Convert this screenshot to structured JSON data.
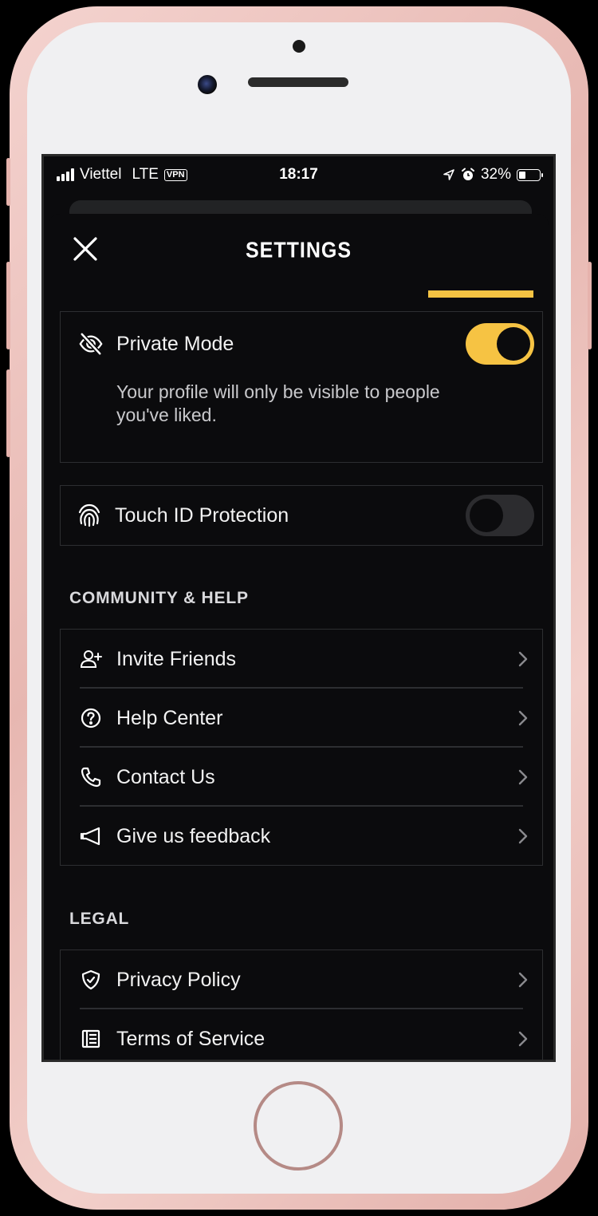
{
  "status_bar": {
    "carrier": "Viettel",
    "network": "LTE",
    "vpn": "VPN",
    "time": "18:17",
    "battery": "32%"
  },
  "header": {
    "title": "SETTINGS",
    "close_icon": "close-icon"
  },
  "accent_color": "#f6c343",
  "private_mode": {
    "label": "Private Mode",
    "description": "Your profile will only be visible to people you've liked.",
    "enabled": true
  },
  "touch_id": {
    "label": "Touch ID Protection",
    "enabled": false
  },
  "community": {
    "section_title": "COMMUNITY & HELP",
    "items": [
      {
        "label": "Invite Friends",
        "icon": "add-user-icon"
      },
      {
        "label": "Help Center",
        "icon": "question-icon"
      },
      {
        "label": "Contact Us",
        "icon": "phone-icon"
      },
      {
        "label": "Give us feedback",
        "icon": "megaphone-icon"
      }
    ]
  },
  "legal": {
    "section_title": "LEGAL",
    "items": [
      {
        "label": "Privacy Policy",
        "icon": "shield-icon"
      },
      {
        "label": "Terms of Service",
        "icon": "document-icon"
      }
    ]
  }
}
